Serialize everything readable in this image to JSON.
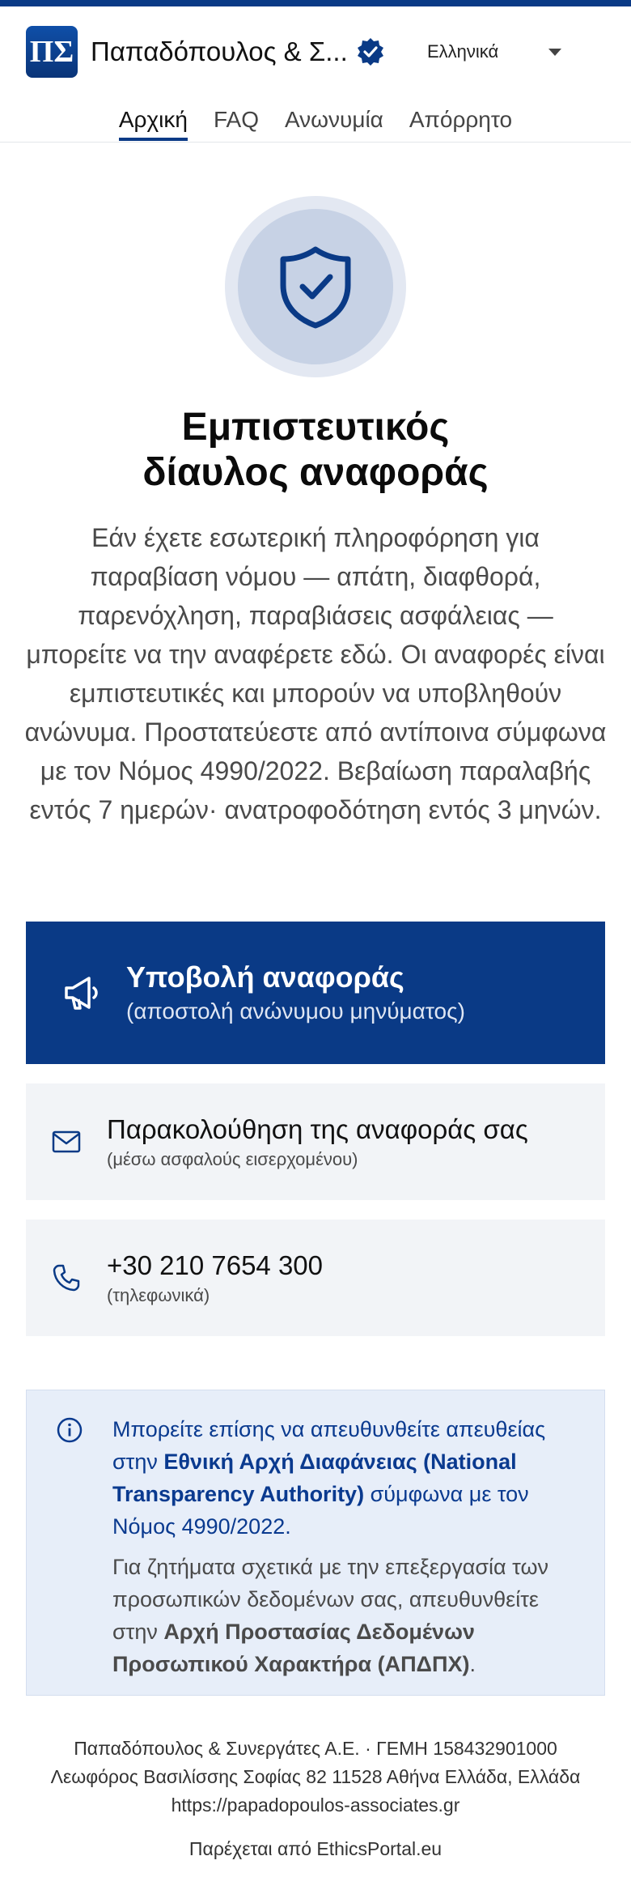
{
  "header": {
    "logo_text": "ΠΣ",
    "company_name": "Παπαδόπουλος & Σ...",
    "language": "Ελληνικά"
  },
  "nav": {
    "items": [
      "Αρχική",
      "FAQ",
      "Ανωνυμία",
      "Απόρρητο"
    ],
    "active": "Αρχική"
  },
  "hero": {
    "title_line1": "Εμπιστευτικός",
    "title_line2": "δίαυλος αναφοράς",
    "intro": "Εάν έχετε εσωτερική πληροφόρηση για παραβίαση νόμου — απάτη, διαφθορά, παρενόχληση, παραβιάσεις ασφάλειας — μπορείτε να την αναφέρετε εδώ. Οι αναφορές είναι εμπιστευτικές και μπορούν να υποβληθούν ανώνυμα. Προστατεύεστε από αντίποινα σύμφωνα με τον Νόμος 4990/2022. Βεβαίωση παραλαβής εντός 7 ημερών· ανατροφοδότηση εντός 3 μηνών."
  },
  "actions": {
    "submit": {
      "title": "Υποβολή αναφοράς",
      "subtitle": "(αποστολή ανώνυμου μηνύματος)"
    },
    "track": {
      "title": "Παρακολούθηση της αναφοράς σας",
      "subtitle": "(μέσω ασφαλούς εισερχομένου)"
    },
    "phone": {
      "title": "+30 210 7654 300",
      "subtitle": "(τηλεφωνικά)"
    }
  },
  "info": {
    "p1_pre": "Μπορείτε επίσης να απευθυνθείτε απευθείας στην ",
    "p1_bold": "Εθνική Αρχή Διαφάνειας (National Transparency Authority)",
    "p1_post": " σύμφωνα με τον Νόμος 4990/2022.",
    "p2_pre": "Για ζητήματα σχετικά με την επεξεργασία των προσωπικών δεδομένων σας, απευθυνθείτε στην ",
    "p2_bold": "Αρχή Προστασίας Δεδομένων Προσωπικού Χαρακτήρα (ΑΠΔΠΧ)",
    "p2_post": "."
  },
  "footer": {
    "line1": "Παπαδόπουλος & Συνεργάτες Α.Ε. · ΓΕΜΗ 158432901000",
    "line2": "Λεωφόρος Βασιλίσσης Σοφίας 82 11528 Αθήνα Ελλάδα, Ελλάδα",
    "line3": "https://papadopoulos-associates.gr",
    "powered": "Παρέχεται από EthicsPortal.eu"
  },
  "colors": {
    "brand": "#0a3a86",
    "secondary_card": "#f2f4f7",
    "info_bg": "#e7eef9"
  }
}
